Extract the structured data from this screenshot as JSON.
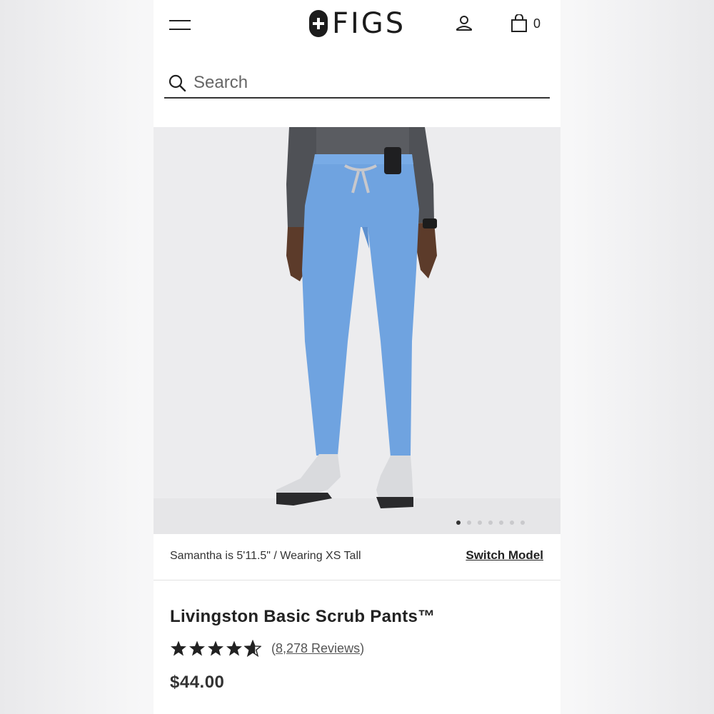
{
  "header": {
    "logo_text": "FIGS",
    "bag_count": "0"
  },
  "search": {
    "placeholder": "Search"
  },
  "gallery": {
    "image_description": "product-photo-model-wearing-blue-scrub-pants",
    "dot_count": 7,
    "active_index": 0
  },
  "model_info": {
    "text": "Samantha is 5'11.5\" / Wearing XS Tall",
    "switch_label": "Switch Model"
  },
  "product": {
    "title": "Livingston Basic Scrub Pants™",
    "rating": 4.5,
    "reviews_open": "(",
    "reviews_label": "8,278 Reviews",
    "reviews_close": ")",
    "price": "$44.00"
  },
  "colors": {
    "pants": "#6fa3e0",
    "text": "#222222",
    "image_bg": "#ececee"
  }
}
